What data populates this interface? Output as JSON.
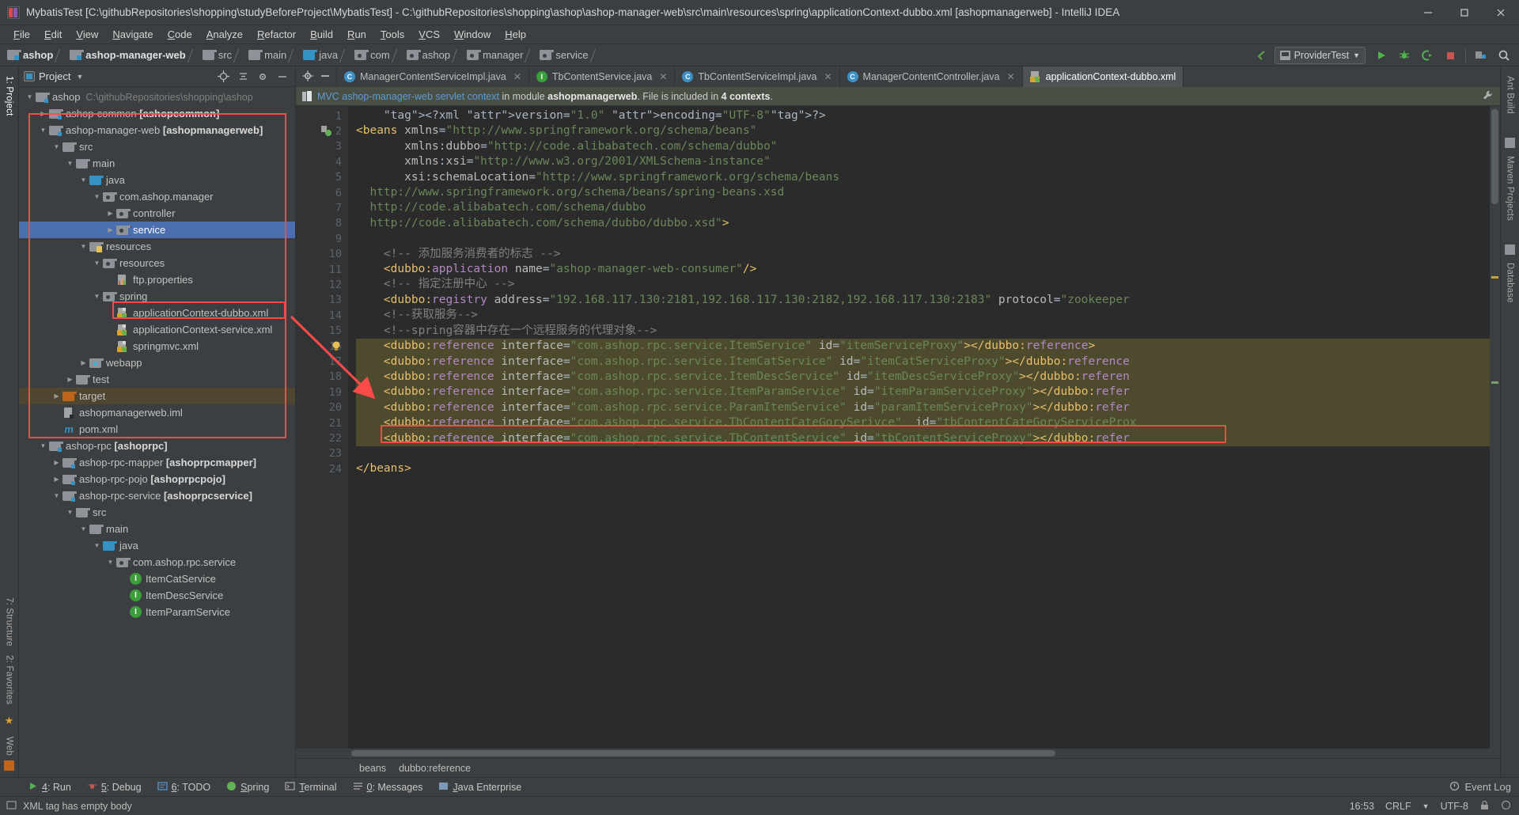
{
  "window": {
    "title": "MybatisTest [C:\\githubRepositories\\shopping\\studyBeforeProject\\MybatisTest] - C:\\githubRepositories\\shopping\\ashop\\ashop-manager-web\\src\\main\\resources\\spring\\applicationContext-dubbo.xml [ashopmanagerweb] - IntelliJ IDEA",
    "minimize": "─",
    "maximize": "□",
    "close": "✕"
  },
  "menu": [
    "File",
    "Edit",
    "View",
    "Navigate",
    "Code",
    "Analyze",
    "Refactor",
    "Build",
    "Run",
    "Tools",
    "VCS",
    "Window",
    "Help"
  ],
  "navbar": {
    "crumbs": [
      {
        "label": "ashop",
        "icon": "module-icon",
        "bold": true
      },
      {
        "label": "ashop-manager-web",
        "icon": "module-icon",
        "bold": true
      },
      {
        "label": "src",
        "icon": "folder-icon",
        "bold": false
      },
      {
        "label": "main",
        "icon": "folder-icon",
        "bold": false
      },
      {
        "label": "java",
        "icon": "source-folder-icon",
        "bold": false
      },
      {
        "label": "com",
        "icon": "package-icon",
        "bold": false
      },
      {
        "label": "ashop",
        "icon": "package-icon",
        "bold": false
      },
      {
        "label": "manager",
        "icon": "package-icon",
        "bold": false
      },
      {
        "label": "service",
        "icon": "package-icon",
        "bold": false
      }
    ],
    "run_config": "ProviderTest",
    "buttons": [
      "back-arrow-icon",
      "run-icon",
      "debug-icon",
      "run-coverage-icon",
      "stop-icon",
      "project-structure-icon",
      "search-everywhere-icon"
    ]
  },
  "left_strip": [
    {
      "label": "1: Project",
      "active": true
    },
    {
      "label": "7: Structure",
      "active": false
    },
    {
      "label": "2: Favorites",
      "active": false
    },
    {
      "label": "Web",
      "active": false
    }
  ],
  "right_strip": [
    {
      "label": "Ant Build"
    },
    {
      "label": "Maven Projects"
    },
    {
      "label": "Database"
    }
  ],
  "project_panel": {
    "title": "Project",
    "tree": [
      {
        "depth": 0,
        "arrow": "down",
        "icon": "module-icon",
        "label": "ashop",
        "bold": true,
        "path": "C:\\githubRepositories\\shopping\\ashop"
      },
      {
        "depth": 1,
        "arrow": "right",
        "icon": "module-icon",
        "label": "ashop-common ",
        "suffix": "[ashopcommon]"
      },
      {
        "depth": 1,
        "arrow": "down",
        "icon": "module-icon",
        "label": "ashop-manager-web ",
        "suffix": "[ashopmanagerweb]"
      },
      {
        "depth": 2,
        "arrow": "down",
        "icon": "folder-icon",
        "label": "src"
      },
      {
        "depth": 3,
        "arrow": "down",
        "icon": "folder-icon",
        "label": "main"
      },
      {
        "depth": 4,
        "arrow": "down",
        "icon": "source-folder-icon",
        "label": "java"
      },
      {
        "depth": 5,
        "arrow": "down",
        "icon": "package-icon",
        "label": "com.ashop.manager"
      },
      {
        "depth": 6,
        "arrow": "right",
        "icon": "package-icon",
        "label": "controller"
      },
      {
        "depth": 6,
        "arrow": "right",
        "icon": "package-icon",
        "label": "service",
        "selected": true
      },
      {
        "depth": 4,
        "arrow": "down",
        "icon": "resources-folder-icon",
        "label": "resources"
      },
      {
        "depth": 5,
        "arrow": "down",
        "icon": "package-icon",
        "label": "resources"
      },
      {
        "depth": 6,
        "arrow": "none",
        "icon": "properties-file-icon",
        "label": "ftp.properties"
      },
      {
        "depth": 5,
        "arrow": "down",
        "icon": "package-icon",
        "label": "spring"
      },
      {
        "depth": 6,
        "arrow": "none",
        "icon": "spring-xml-icon",
        "label": "applicationContext-dubbo.xml",
        "boxed": true
      },
      {
        "depth": 6,
        "arrow": "none",
        "icon": "spring-xml-icon",
        "label": "applicationContext-service.xml"
      },
      {
        "depth": 6,
        "arrow": "none",
        "icon": "spring-xml-icon",
        "label": "springmvc.xml"
      },
      {
        "depth": 4,
        "arrow": "right",
        "icon": "webapp-folder-icon",
        "label": "webapp"
      },
      {
        "depth": 3,
        "arrow": "right",
        "icon": "folder-icon",
        "label": "test"
      },
      {
        "depth": 2,
        "arrow": "right",
        "icon": "target-folder-icon",
        "label": "target",
        "highlight": true
      },
      {
        "depth": 2,
        "arrow": "none",
        "icon": "iml-file-icon",
        "label": "ashopmanagerweb.iml"
      },
      {
        "depth": 2,
        "arrow": "none",
        "icon": "maven-file-icon",
        "label": "pom.xml"
      },
      {
        "depth": 1,
        "arrow": "down",
        "icon": "module-icon",
        "label": "ashop-rpc ",
        "suffix": "[ashoprpc]"
      },
      {
        "depth": 2,
        "arrow": "right",
        "icon": "module-icon",
        "label": "ashop-rpc-mapper ",
        "suffix": "[ashoprpcmapper]"
      },
      {
        "depth": 2,
        "arrow": "right",
        "icon": "module-icon",
        "label": "ashop-rpc-pojo ",
        "suffix": "[ashoprpcpojo]"
      },
      {
        "depth": 2,
        "arrow": "down",
        "icon": "module-icon",
        "label": "ashop-rpc-service ",
        "suffix": "[ashoprpcservice]"
      },
      {
        "depth": 3,
        "arrow": "down",
        "icon": "folder-icon",
        "label": "src"
      },
      {
        "depth": 4,
        "arrow": "down",
        "icon": "folder-icon",
        "label": "main"
      },
      {
        "depth": 5,
        "arrow": "down",
        "icon": "source-folder-icon",
        "label": "java"
      },
      {
        "depth": 6,
        "arrow": "down",
        "icon": "package-icon",
        "label": "com.ashop.rpc.service"
      },
      {
        "depth": 7,
        "arrow": "none",
        "icon": "interface-icon",
        "label": "ItemCatService"
      },
      {
        "depth": 7,
        "arrow": "none",
        "icon": "interface-icon",
        "label": "ItemDescService"
      },
      {
        "depth": 7,
        "arrow": "none",
        "icon": "interface-icon",
        "label": "ItemParamService"
      }
    ]
  },
  "editor": {
    "tabs": [
      {
        "label": "ManagerContentServiceImpl.java",
        "icon": "class-icon",
        "active": false
      },
      {
        "label": "TbContentService.java",
        "icon": "interface-icon",
        "active": false
      },
      {
        "label": "TbContentServiceImpl.java",
        "icon": "class-icon",
        "active": false
      },
      {
        "label": "ManagerContentController.java",
        "icon": "class-icon",
        "active": false
      },
      {
        "label": "applicationContext-dubbo.xml",
        "icon": "spring-xml-icon",
        "active": true
      }
    ],
    "context_banner": {
      "link": "MVC ashop-manager-web servlet context",
      "mid": " in module ",
      "module": "ashopmanagerweb",
      "tail": ". File is included in ",
      "contexts": "4 contexts",
      "end": "."
    },
    "breadcrumb": [
      "beans",
      "dubbo:reference"
    ],
    "lines": [
      {
        "n": 1,
        "text": "    <?xml version=\"1.0\" encoding=\"UTF-8\"?>"
      },
      {
        "n": 2,
        "text": "<beans xmlns=\"http://www.springframework.org/schema/beans\""
      },
      {
        "n": 3,
        "text": "       xmlns:dubbo=\"http://code.alibabatech.com/schema/dubbo\""
      },
      {
        "n": 4,
        "text": "       xmlns:xsi=\"http://www.w3.org/2001/XMLSchema-instance\""
      },
      {
        "n": 5,
        "text": "       xsi:schemaLocation=\"http://www.springframework.org/schema/beans"
      },
      {
        "n": 6,
        "text": "  http://www.springframework.org/schema/beans/spring-beans.xsd"
      },
      {
        "n": 7,
        "text": "  http://code.alibabatech.com/schema/dubbo"
      },
      {
        "n": 8,
        "text": "  http://code.alibabatech.com/schema/dubbo/dubbo.xsd\">"
      },
      {
        "n": 9,
        "text": ""
      },
      {
        "n": 10,
        "text": "    <!-- 添加服务消费者的标志 -->"
      },
      {
        "n": 11,
        "text": "    <dubbo:application name=\"ashop-manager-web-consumer\"/>"
      },
      {
        "n": 12,
        "text": "    <!-- 指定注册中心 -->"
      },
      {
        "n": 13,
        "text": "    <dubbo:registry address=\"192.168.117.130:2181,192.168.117.130:2182,192.168.117.130:2183\" protocol=\"zookeeper"
      },
      {
        "n": 14,
        "text": "    <!--获取服务-->"
      },
      {
        "n": 15,
        "text": "    <!--spring容器中存在一个远程服务的代理对象-->"
      },
      {
        "n": 16,
        "text": "    <dubbo:reference interface=\"com.ashop.rpc.service.ItemService\" id=\"itemServiceProxy\"></dubbo:reference>"
      },
      {
        "n": 17,
        "text": "    <dubbo:reference interface=\"com.ashop.rpc.service.ItemCatService\" id=\"itemCatServiceProxy\"></dubbo:reference"
      },
      {
        "n": 18,
        "text": "    <dubbo:reference interface=\"com.ashop.rpc.service.ItemDescService\" id=\"itemDescServiceProxy\"></dubbo:referen"
      },
      {
        "n": 19,
        "text": "    <dubbo:reference interface=\"com.ashop.rpc.service.ItemParamService\" id=\"itemParamServiceProxy\"></dubbo:refer"
      },
      {
        "n": 20,
        "text": "    <dubbo:reference interface=\"com.ashop.rpc.service.ParamItemService\" id=\"paramItemServiceProxy\"></dubbo:refer"
      },
      {
        "n": 21,
        "text": "    <dubbo:reference interface=\"com.ashop.rpc.service.TbContentCateGorySerivce\"  id=\"tbContentCateGoryServiceProx"
      },
      {
        "n": 22,
        "text": "    <dubbo:reference interface=\"com.ashop.rpc.service.TbContentService\" id=\"tbContentServiceProxy\"></dubbo:refer"
      },
      {
        "n": 23,
        "text": ""
      },
      {
        "n": 24,
        "text": "</beans>"
      }
    ]
  },
  "bottom_toolbar": [
    {
      "label": "4: Run",
      "icon": "run-icon"
    },
    {
      "label": "5: Debug",
      "icon": "debug-icon"
    },
    {
      "label": "6: TODO",
      "icon": "todo-icon"
    },
    {
      "label": "Spring",
      "icon": "spring-icon"
    },
    {
      "label": "Terminal",
      "icon": "terminal-icon"
    },
    {
      "label": "0: Messages",
      "icon": "messages-icon"
    },
    {
      "label": "Java Enterprise",
      "icon": "java-ee-icon"
    }
  ],
  "bottom_right": {
    "event_log": "Event Log"
  },
  "statusbar": {
    "message": "XML tag has empty body",
    "time": "16:53",
    "line_separator": "CRLF",
    "encoding": "UTF-8"
  }
}
